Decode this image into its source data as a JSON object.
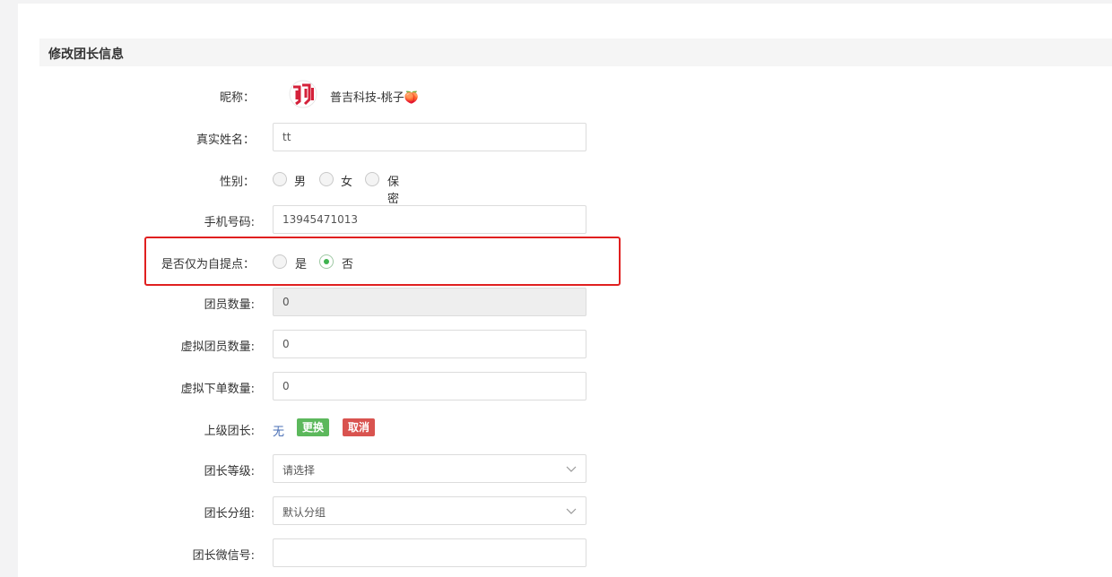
{
  "section": {
    "title": "修改团长信息"
  },
  "nickname": {
    "label": "昵称：",
    "value": "普吉科技-桃子🍑"
  },
  "real_name": {
    "label": "真实姓名：",
    "value": "tt"
  },
  "gender": {
    "label": "性别：",
    "options": [
      "男",
      "女",
      "保密"
    ],
    "selected": null
  },
  "phone": {
    "label": "手机号码:",
    "value": "13945471013"
  },
  "self_pickup": {
    "label": "是否仅为自提点：",
    "options": [
      "是",
      "否"
    ],
    "selected": "否"
  },
  "member_count": {
    "label": "团员数量:",
    "value": "0"
  },
  "virtual_member_count": {
    "label": "虚拟团员数量:",
    "value": "0"
  },
  "virtual_order_count": {
    "label": "虚拟下单数量:",
    "value": "0"
  },
  "superior": {
    "label": "上级团长:",
    "value": "无",
    "change_btn": "更换",
    "cancel_btn": "取消"
  },
  "level": {
    "label": "团长等级:",
    "value": "请选择"
  },
  "group": {
    "label": "团长分组:",
    "value": "默认分组"
  },
  "wechat": {
    "label": "团长微信号:",
    "value": ""
  },
  "colors": {
    "accent_green": "#3fb34f",
    "btn_green": "#5cb85c",
    "btn_red": "#d9534f",
    "highlight_red": "#e02020"
  }
}
